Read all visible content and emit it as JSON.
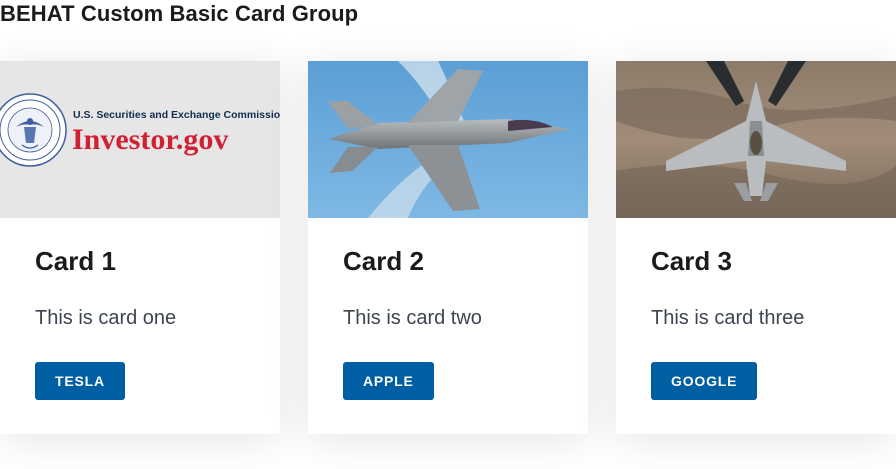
{
  "group": {
    "title": "BEHAT Custom Basic Card Group"
  },
  "cards": [
    {
      "image": {
        "org_line": "U.S. Securities and Exchange Commission",
        "logo_text": "Investor.gov",
        "seal_text": "SECURITIES AND EXCHANGE COMMISSION MCMXXXIV"
      },
      "heading": "Card 1",
      "text": "This is card one",
      "button_label": "TESLA"
    },
    {
      "image": {
        "subject": "fighter jet in flight against blue sky"
      },
      "heading": "Card 2",
      "text": "This is card two",
      "button_label": "APPLE"
    },
    {
      "image": {
        "subject": "fighter jet over desert terrain"
      },
      "heading": "Card 3",
      "text": "This is card three",
      "button_label": "GOOGLE"
    }
  ],
  "colors": {
    "button_bg": "#005ea2",
    "logo_red": "#d21f32",
    "logo_navy": "#112e51"
  }
}
